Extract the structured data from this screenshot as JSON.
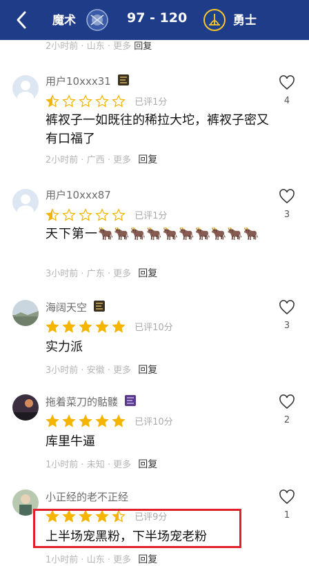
{
  "header": {
    "away_team": "魔术",
    "score": "97 - 120",
    "home_team": "勇士",
    "away_logo_icon": "magic-logo-icon",
    "home_logo_icon": "warriors-logo-icon"
  },
  "partial_meta": {
    "time": "2小时前",
    "location": "山东",
    "more": "更多",
    "reply": "回复"
  },
  "comments": [
    {
      "user": "用户10xxx31",
      "has_badge": true,
      "rating": 1,
      "score_text": "已评1分",
      "text": "裤衩子一如既往的稀拉大坨，裤衩子密又有口福了",
      "time": "2小时前",
      "location": "广西",
      "more": "更多",
      "reply": "回复",
      "likes": "4"
    },
    {
      "user": "用户10xxx87",
      "has_badge": false,
      "rating": 1,
      "score_text": "已评1分",
      "text": "天下第一🐂🐂🐂🐂🐂🐂🐂🐂🐂🐂",
      "time": "3小时前",
      "location": "广东",
      "more": "更多",
      "reply": "回复",
      "likes": "3"
    },
    {
      "user": "海阔天空",
      "has_badge": true,
      "rating": 5,
      "score_text": "已评10分",
      "text": "实力派",
      "time": "3小时前",
      "location": "安徽",
      "more": "更多",
      "reply": "回复",
      "likes": "3"
    },
    {
      "user": "拖着菜刀的骷髅",
      "has_badge": true,
      "rating": 5,
      "score_text": "已评10分",
      "text": "库里牛逼",
      "time": "1小时前",
      "location": "未知",
      "more": "更多",
      "reply": "回复",
      "likes": "2"
    },
    {
      "user": "小正经的老不正经",
      "has_badge": false,
      "rating": 4.5,
      "score_text": "已评9分",
      "text": "上半场宠黑粉，下半场宠老粉",
      "time": "1小时前",
      "location": "山东",
      "more": "更多",
      "reply": "回复",
      "likes": "1"
    }
  ],
  "colors": {
    "header_bg": "#1f3c88",
    "star": "#f5b400",
    "highlight": "#e01f2a"
  }
}
